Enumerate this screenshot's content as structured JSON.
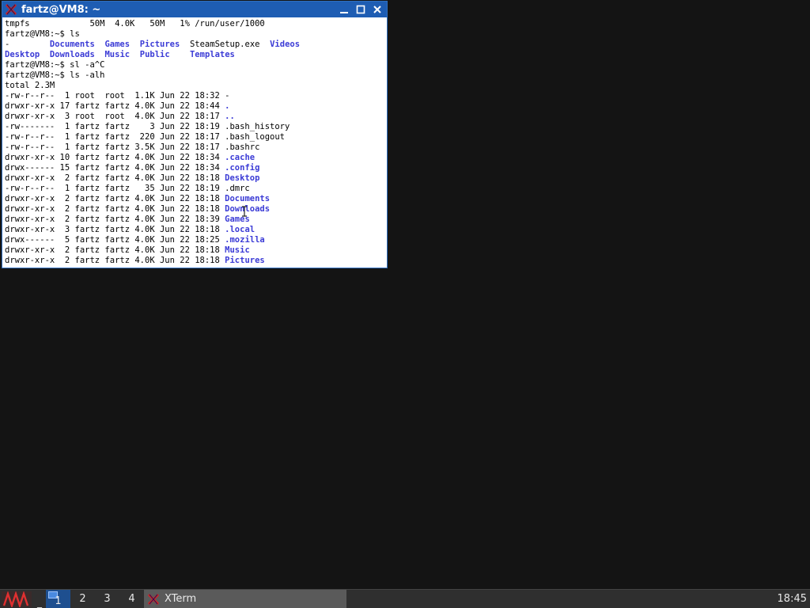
{
  "window": {
    "title": "fartz@VM8: ~",
    "buttons": {
      "minimize": "minimize",
      "maximize": "maximize",
      "close": "close"
    }
  },
  "terminal": {
    "lines": [
      [
        {
          "t": "tmpfs            50M  4.0K   50M   1% /run/user/1000"
        }
      ],
      [
        {
          "t": "fartz@VM8:~$ ls"
        }
      ],
      [
        {
          "t": "-        "
        },
        {
          "t": "Documents",
          "d": true
        },
        {
          "t": "  "
        },
        {
          "t": "Games",
          "d": true
        },
        {
          "t": "  "
        },
        {
          "t": "Pictures",
          "d": true
        },
        {
          "t": "  SteamSetup.exe  "
        },
        {
          "t": "Videos",
          "d": true
        }
      ],
      [
        {
          "t": "Desktop",
          "d": true
        },
        {
          "t": "  "
        },
        {
          "t": "Downloads",
          "d": true
        },
        {
          "t": "  "
        },
        {
          "t": "Music",
          "d": true
        },
        {
          "t": "  "
        },
        {
          "t": "Public",
          "d": true
        },
        {
          "t": "    "
        },
        {
          "t": "Templates",
          "d": true
        }
      ],
      [
        {
          "t": "fartz@VM8:~$ sl -a^C"
        }
      ],
      [
        {
          "t": "fartz@VM8:~$ ls -alh"
        }
      ],
      [
        {
          "t": "total 2.3M"
        }
      ],
      [
        {
          "t": "-rw-r--r--  1 root  root  1.1K Jun 22 18:32 -"
        }
      ],
      [
        {
          "t": "drwxr-xr-x 17 fartz fartz 4.0K Jun 22 18:44 "
        },
        {
          "t": ".",
          "d": true
        }
      ],
      [
        {
          "t": "drwxr-xr-x  3 root  root  4.0K Jun 22 18:17 "
        },
        {
          "t": "..",
          "d": true
        }
      ],
      [
        {
          "t": "-rw-------  1 fartz fartz    3 Jun 22 18:19 .bash_history"
        }
      ],
      [
        {
          "t": "-rw-r--r--  1 fartz fartz  220 Jun 22 18:17 .bash_logout"
        }
      ],
      [
        {
          "t": "-rw-r--r--  1 fartz fartz 3.5K Jun 22 18:17 .bashrc"
        }
      ],
      [
        {
          "t": "drwxr-xr-x 10 fartz fartz 4.0K Jun 22 18:34 "
        },
        {
          "t": ".cache",
          "d": true
        }
      ],
      [
        {
          "t": "drwx------ 15 fartz fartz 4.0K Jun 22 18:34 "
        },
        {
          "t": ".config",
          "d": true
        }
      ],
      [
        {
          "t": "drwxr-xr-x  2 fartz fartz 4.0K Jun 22 18:18 "
        },
        {
          "t": "Desktop",
          "d": true
        }
      ],
      [
        {
          "t": "-rw-r--r--  1 fartz fartz   35 Jun 22 18:19 .dmrc"
        }
      ],
      [
        {
          "t": "drwxr-xr-x  2 fartz fartz 4.0K Jun 22 18:18 "
        },
        {
          "t": "Documents",
          "d": true
        }
      ],
      [
        {
          "t": "drwxr-xr-x  2 fartz fartz 4.0K Jun 22 18:18 "
        },
        {
          "t": "Downloads",
          "d": true
        }
      ],
      [
        {
          "t": "drwxr-xr-x  2 fartz fartz 4.0K Jun 22 18:39 "
        },
        {
          "t": "Games",
          "d": true
        }
      ],
      [
        {
          "t": "drwxr-xr-x  3 fartz fartz 4.0K Jun 22 18:18 "
        },
        {
          "t": ".local",
          "d": true
        }
      ],
      [
        {
          "t": "drwx------  5 fartz fartz 4.0K Jun 22 18:25 "
        },
        {
          "t": ".mozilla",
          "d": true
        }
      ],
      [
        {
          "t": "drwxr-xr-x  2 fartz fartz 4.0K Jun 22 18:18 "
        },
        {
          "t": "Music",
          "d": true
        }
      ],
      [
        {
          "t": "drwxr-xr-x  2 fartz fartz 4.0K Jun 22 18:18 "
        },
        {
          "t": "Pictures",
          "d": true
        }
      ]
    ]
  },
  "taskbar": {
    "desktops": [
      "1",
      "2",
      "3",
      "4"
    ],
    "active_desktop": "1",
    "minimize_all_glyph": "_",
    "task": {
      "label": "XTerm",
      "icon": "xterm-icon"
    },
    "menu_icon": "menu-logo-icon",
    "clock": "18:45"
  },
  "colors": {
    "titlebar": "#1e5db3",
    "directory": "#3b3bd6",
    "desktop_background": "#141414",
    "taskbar": "#2f2f2f"
  }
}
